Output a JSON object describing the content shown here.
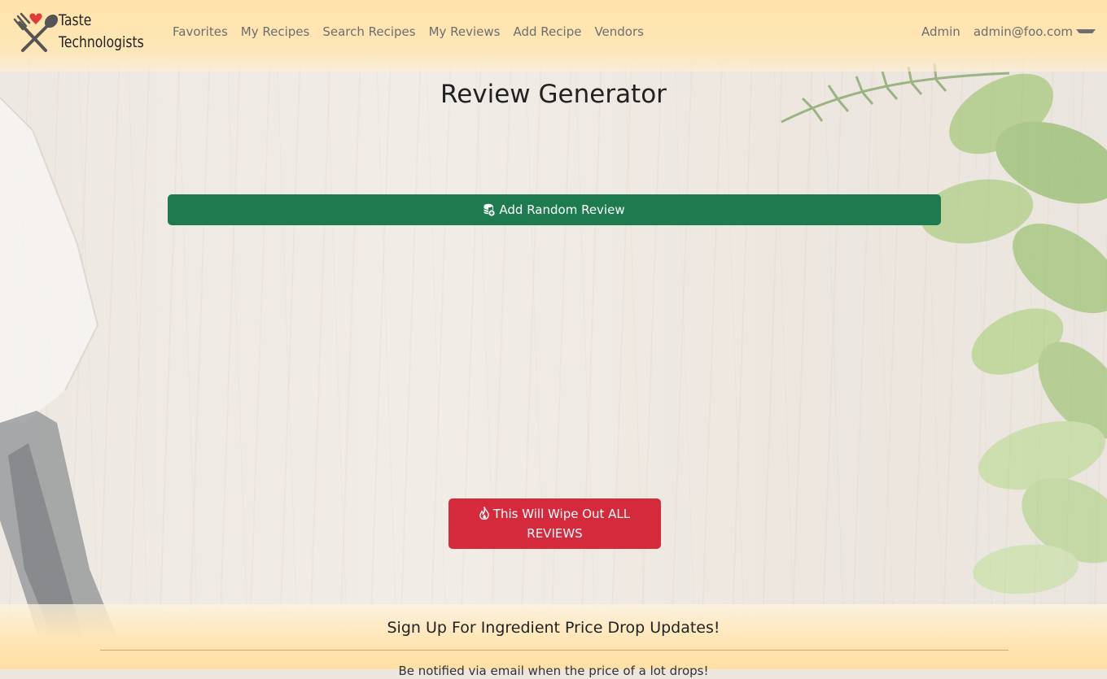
{
  "brand": {
    "line1": "Taste",
    "line2": "Technologists",
    "logo_icon": "fork-spoon-heart-icon"
  },
  "nav": {
    "links": [
      "Favorites",
      "My Recipes",
      "Search Recipes",
      "My Reviews",
      "Add Recipe",
      "Vendors"
    ],
    "admin": "Admin",
    "user": "admin@foo.com"
  },
  "main": {
    "title": "Review Generator",
    "add_button": {
      "label": "Add Random Review",
      "icon": "database-add-icon",
      "color": "#1e7b4f"
    },
    "wipe_button": {
      "label": "This Will Wipe Out ALL REVIEWS",
      "icon": "fire-icon",
      "color": "#d52a3b"
    }
  },
  "footer": {
    "title": "Sign Up For Ingredient Price Drop Updates!",
    "subtitle": "Be notified via email when the price of a lot drops!"
  }
}
